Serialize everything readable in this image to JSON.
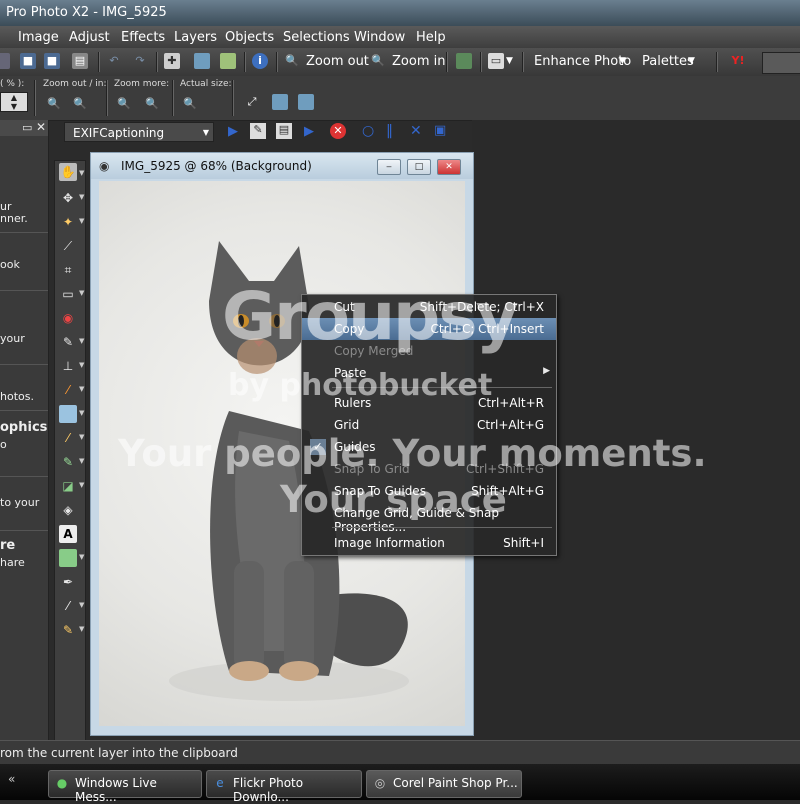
{
  "window": {
    "title": "Pro Photo X2 - IMG_5925"
  },
  "menu": [
    "Image",
    "Adjust",
    "Effects",
    "Layers",
    "Objects",
    "Selections",
    "Window",
    "Help"
  ],
  "toolbar": {
    "zoom_out": "Zoom out",
    "zoom_in": "Zoom in",
    "enhance_photo": "Enhance Photo",
    "palettes": "Palettes"
  },
  "toolbar2": {
    "zoom_pct_label": "( % ):",
    "zoom_out_in_label": "Zoom out / in:",
    "zoom_more_label": "Zoom more:",
    "actual_size_label": "Actual size:"
  },
  "script": {
    "selected": "EXIFCaptioning"
  },
  "left_panel": {
    "texts": [
      "ur",
      "nner.",
      "ook",
      "your",
      "hotos.",
      "ophics",
      "o",
      "to your",
      "re",
      "hare"
    ]
  },
  "image_window": {
    "title": "IMG_5925 @  68% (Background)"
  },
  "context_menu": {
    "items": [
      {
        "label": "Cut",
        "shortcut": "Shift+Delete; Ctrl+X",
        "enabled": true
      },
      {
        "label": "Copy",
        "shortcut": "Ctrl+C; Ctrl+Insert",
        "enabled": true,
        "highlighted": true
      },
      {
        "label": "Copy Merged",
        "shortcut": "",
        "enabled": false
      },
      {
        "label": "Paste",
        "shortcut": "",
        "enabled": true,
        "submenu": true
      },
      {
        "label": "Rulers",
        "shortcut": "Ctrl+Alt+R",
        "enabled": true
      },
      {
        "label": "Grid",
        "shortcut": "Ctrl+Alt+G",
        "enabled": true
      },
      {
        "label": "Guides",
        "shortcut": "",
        "enabled": true,
        "checked": true
      },
      {
        "label": "Snap To Grid",
        "shortcut": "Ctrl+Shift+G",
        "enabled": false
      },
      {
        "label": "Snap To Guides",
        "shortcut": "Shift+Alt+G",
        "enabled": true
      },
      {
        "label": "Change Grid, Guide & Snap Properties...",
        "shortcut": "",
        "enabled": true
      },
      {
        "label": "Image Information",
        "shortcut": "Shift+I",
        "enabled": true
      }
    ]
  },
  "watermark": {
    "logo": "Groupsy",
    "by": "by photobucket",
    "line1": "Your people. Your moments.",
    "line2": "Your space"
  },
  "status": {
    "text": "rom the current layer into the clipboard"
  },
  "taskbar": {
    "tasks": [
      "Windows Live Mess...",
      "Flickr Photo Downlo...",
      "Corel Paint Shop Pr..."
    ]
  },
  "colors": {
    "highlight": "#4a6c92",
    "background": "#2b2b2b"
  }
}
